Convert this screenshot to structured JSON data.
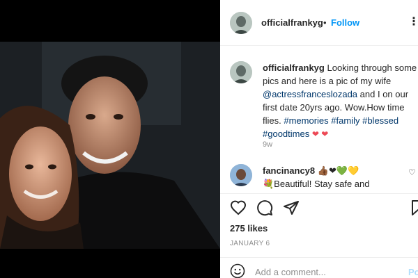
{
  "post": {
    "username": "officialfrankyg",
    "follow_dot": "•",
    "follow_label": "Follow",
    "more_label": "⋮"
  },
  "caption": {
    "username": "officialfrankyg",
    "text_1": "Looking through some pics and here is a pic of my wife",
    "mention": "@actressfranceslozada",
    "text_2": "and I on our first date 20yrs ago. Wow.How time flies.",
    "tags": [
      "#memories",
      "#family",
      "#blessed",
      "#goodtimes"
    ],
    "hearts": "❤ ❤",
    "time_ago": "9w"
  },
  "comment": {
    "username": "fancinancy8",
    "emojis": "👍🏾❤💚💛",
    "text": "💐Beautiful! Stay safe and Healthy and be blessed 🙏🏾🙏🏾😊"
  },
  "actions": {
    "likes": "275 likes",
    "date": "JANUARY 6"
  },
  "add_comment": {
    "placeholder": "Add a comment...",
    "post_label": "Po"
  },
  "colors": {
    "link_blue": "#0095f6",
    "hashtag": "#00376b",
    "heart_red": "#ed4956",
    "muted": "#8e8e8e"
  }
}
